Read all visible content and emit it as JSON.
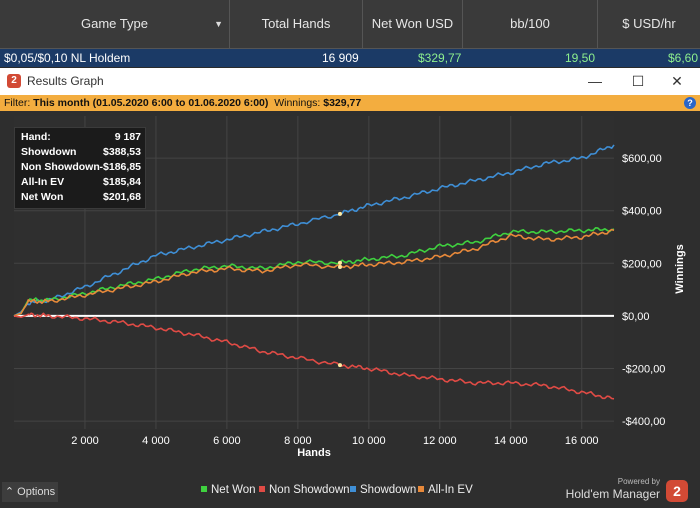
{
  "header": {
    "columns": [
      {
        "label": "Game Type"
      },
      {
        "label": "Total Hands"
      },
      {
        "label": "Net Won USD"
      },
      {
        "label": "bb/100"
      },
      {
        "label": "$ USD/hr"
      }
    ],
    "row": {
      "game": "$0,05/$0,10 NL Holdem",
      "hands": "16 909",
      "net_won": "$329,77",
      "bb100": "19,50",
      "usd_hr": "$6,60"
    }
  },
  "window": {
    "title": "Results Graph",
    "minimize": "—",
    "maximize": "☐",
    "close": "✕"
  },
  "filter": {
    "prefix": "Filter: ",
    "range": "This month (01.05.2020 6:00 to 01.06.2020 6:00)",
    "winnings_label": "Winnings: ",
    "winnings": "$329,77",
    "help": "?"
  },
  "stats": [
    {
      "label": "Hand:",
      "value": "9 187"
    },
    {
      "label": "Showdown",
      "value": "$388,53"
    },
    {
      "label": "Non Showdown",
      "value": "-$186,85"
    },
    {
      "label": "All-In EV",
      "value": "$185,84"
    },
    {
      "label": "Net Won",
      "value": "$201,68"
    }
  ],
  "bottom": {
    "options": "⌃  Options",
    "powered": "Powered by",
    "brand": "Hold'em Manager",
    "logo": "2"
  },
  "chart_data": {
    "type": "line",
    "xlabel": "Hands",
    "ylabel": "Winnings",
    "xlim": [
      0,
      16909
    ],
    "ylim": [
      -430,
      760
    ],
    "x_ticks": [
      2000,
      4000,
      6000,
      8000,
      10000,
      12000,
      14000,
      16000
    ],
    "x_tick_labels": [
      "2 000",
      "4 000",
      "6 000",
      "8 000",
      "10 000",
      "12 000",
      "14 000",
      "16 000"
    ],
    "y_ticks": [
      -400,
      -200,
      0,
      200,
      400,
      600
    ],
    "y_tick_labels": [
      "-$400,00",
      "-$200,00",
      "$0,00",
      "$200,00",
      "$400,00",
      "$600,00"
    ],
    "grid": true,
    "legend_position": "bottom",
    "series": [
      {
        "name": "Showdown",
        "color": "#3f8fd6",
        "x": [
          0,
          200,
          400,
          1000,
          2000,
          3000,
          4000,
          5000,
          6000,
          7000,
          8000,
          9187,
          10000,
          11000,
          12000,
          13000,
          14000,
          15000,
          16000,
          16909
        ],
        "y": [
          0,
          15,
          50,
          60,
          110,
          170,
          230,
          260,
          290,
          320,
          350,
          388,
          420,
          450,
          485,
          515,
          545,
          580,
          600,
          650
        ]
      },
      {
        "name": "Net Won",
        "color": "#3fd13f",
        "x": [
          0,
          200,
          400,
          1000,
          2000,
          3000,
          4000,
          5000,
          6000,
          7000,
          8000,
          9187,
          10000,
          11000,
          12000,
          13000,
          14000,
          15000,
          16000,
          16909
        ],
        "y": [
          0,
          10,
          60,
          60,
          85,
          115,
          140,
          175,
          190,
          180,
          205,
          202,
          215,
          230,
          265,
          280,
          320,
          320,
          325,
          330
        ]
      },
      {
        "name": "All-In EV",
        "color": "#e8893a",
        "x": [
          0,
          200,
          400,
          1000,
          2000,
          3000,
          4000,
          5000,
          6000,
          7000,
          8000,
          9187,
          10000,
          11000,
          12000,
          13000,
          14000,
          15000,
          16000,
          16909
        ],
        "y": [
          0,
          10,
          55,
          55,
          80,
          105,
          130,
          165,
          180,
          170,
          195,
          186,
          195,
          205,
          225,
          255,
          305,
          290,
          300,
          325
        ]
      },
      {
        "name": "Non Showdown",
        "color": "#e04b45",
        "x": [
          0,
          200,
          400,
          1000,
          2000,
          3000,
          4000,
          5000,
          6000,
          7000,
          8000,
          9187,
          10000,
          11000,
          12000,
          13000,
          14000,
          15000,
          16000,
          16909
        ],
        "y": [
          0,
          -5,
          5,
          0,
          -10,
          -25,
          -45,
          -70,
          -100,
          -135,
          -160,
          -187,
          -200,
          -225,
          -240,
          -255,
          -255,
          -265,
          -290,
          -315
        ]
      }
    ],
    "zero_line_color": "#ffffff",
    "marker_x": 9187
  }
}
